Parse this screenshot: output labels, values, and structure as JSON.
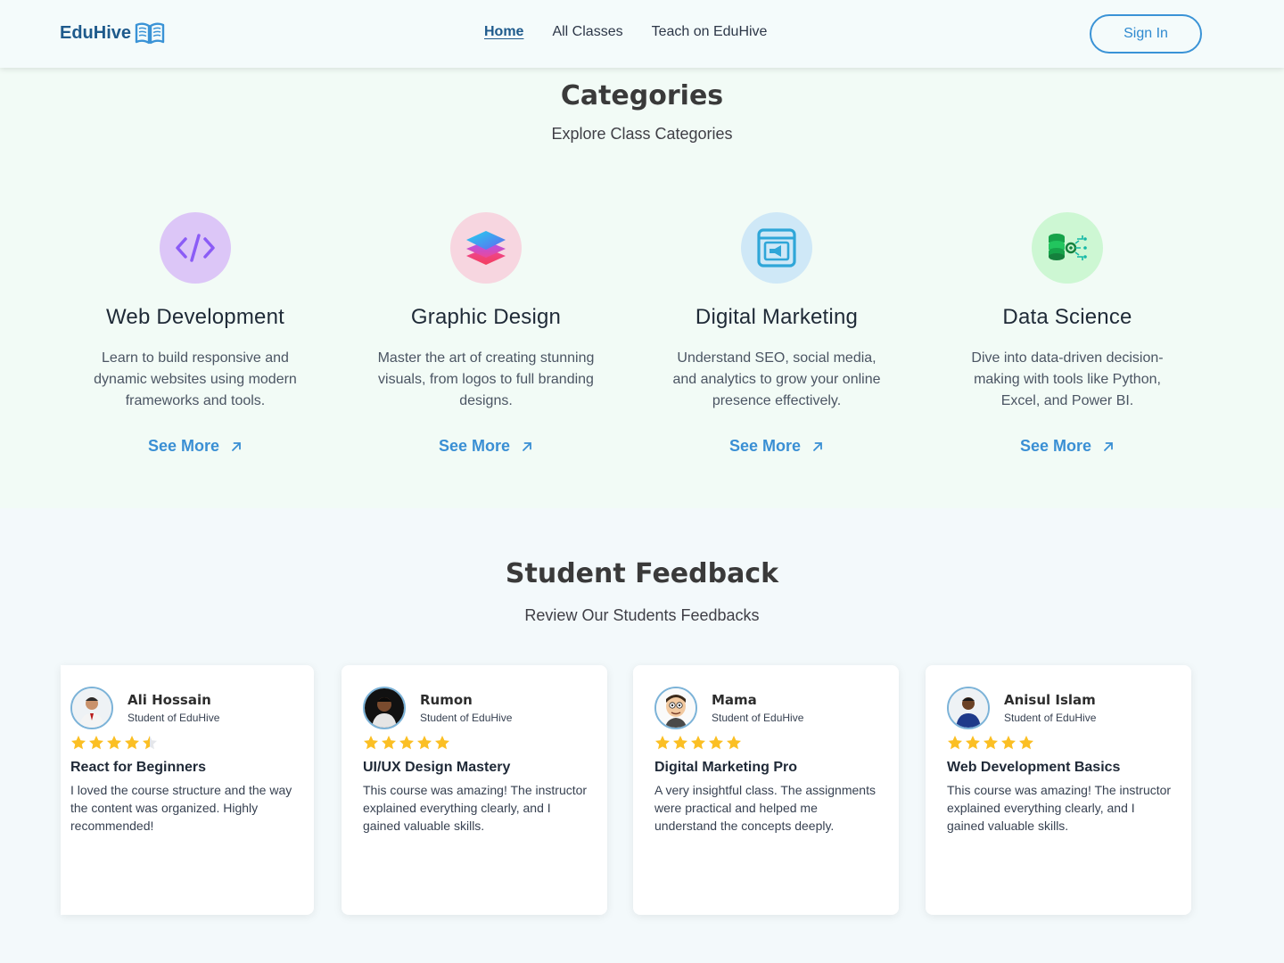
{
  "header": {
    "logo_text": "EduHive",
    "logo_icon": "open-book-icon",
    "nav": [
      {
        "label": "Home",
        "active": true
      },
      {
        "label": "All Classes",
        "active": false
      },
      {
        "label": "Teach on EduHive",
        "active": false
      }
    ],
    "signin_label": "Sign In",
    "brand_color": "#1e5a8c",
    "accent_color": "#3a93d6"
  },
  "categories": {
    "title": "Categories",
    "subtitle": "Explore Class Categories",
    "items": [
      {
        "name": "Web Development",
        "icon": "code-icon",
        "icon_bg": "#dcc6f7",
        "description": "Learn to build responsive and dynamic websites using modern frameworks and tools.",
        "link_label": "See More"
      },
      {
        "name": "Graphic Design",
        "icon": "layers-icon",
        "icon_bg": "#f7d6e0",
        "description": "Master the art of creating stunning visuals, from logos to full branding designs.",
        "link_label": "See More"
      },
      {
        "name": "Digital Marketing",
        "icon": "megaphone-icon",
        "icon_bg": "#cfe8f7",
        "description": "Understand SEO, social media, and analytics to grow your online presence effectively.",
        "link_label": "See More"
      },
      {
        "name": "Data Science",
        "icon": "database-icon",
        "icon_bg": "#cdf7d3",
        "description": "Dive into data-driven decision-making with tools like Python, Excel, and Power BI.",
        "link_label": "See More"
      }
    ]
  },
  "feedback": {
    "title": "Student Feedback",
    "subtitle": "Review Our Students Feedbacks",
    "items": [
      {
        "name": "Ali Hossain",
        "role": "Student of EduHive",
        "rating": 4.5,
        "course": "React for Beginners",
        "text": "I loved the course structure and the way the content was organized. Highly recommended!"
      },
      {
        "name": "Rumon",
        "role": "Student of EduHive",
        "rating": 5,
        "course": "UI/UX Design Mastery",
        "text": "This course was amazing! The instructor explained everything clearly, and I gained valuable skills."
      },
      {
        "name": "Mama",
        "role": "Student of EduHive",
        "rating": 5,
        "course": "Digital Marketing Pro",
        "text": "A very insightful class. The assignments were practical and helped me understand the concepts deeply."
      },
      {
        "name": "Anisul Islam",
        "role": "Student of EduHive",
        "rating": 5,
        "course": "Web Development Basics",
        "text": "This course was amazing! The instructor explained everything clearly, and I gained valuable skills."
      }
    ],
    "star_color": "#fbbf24"
  }
}
